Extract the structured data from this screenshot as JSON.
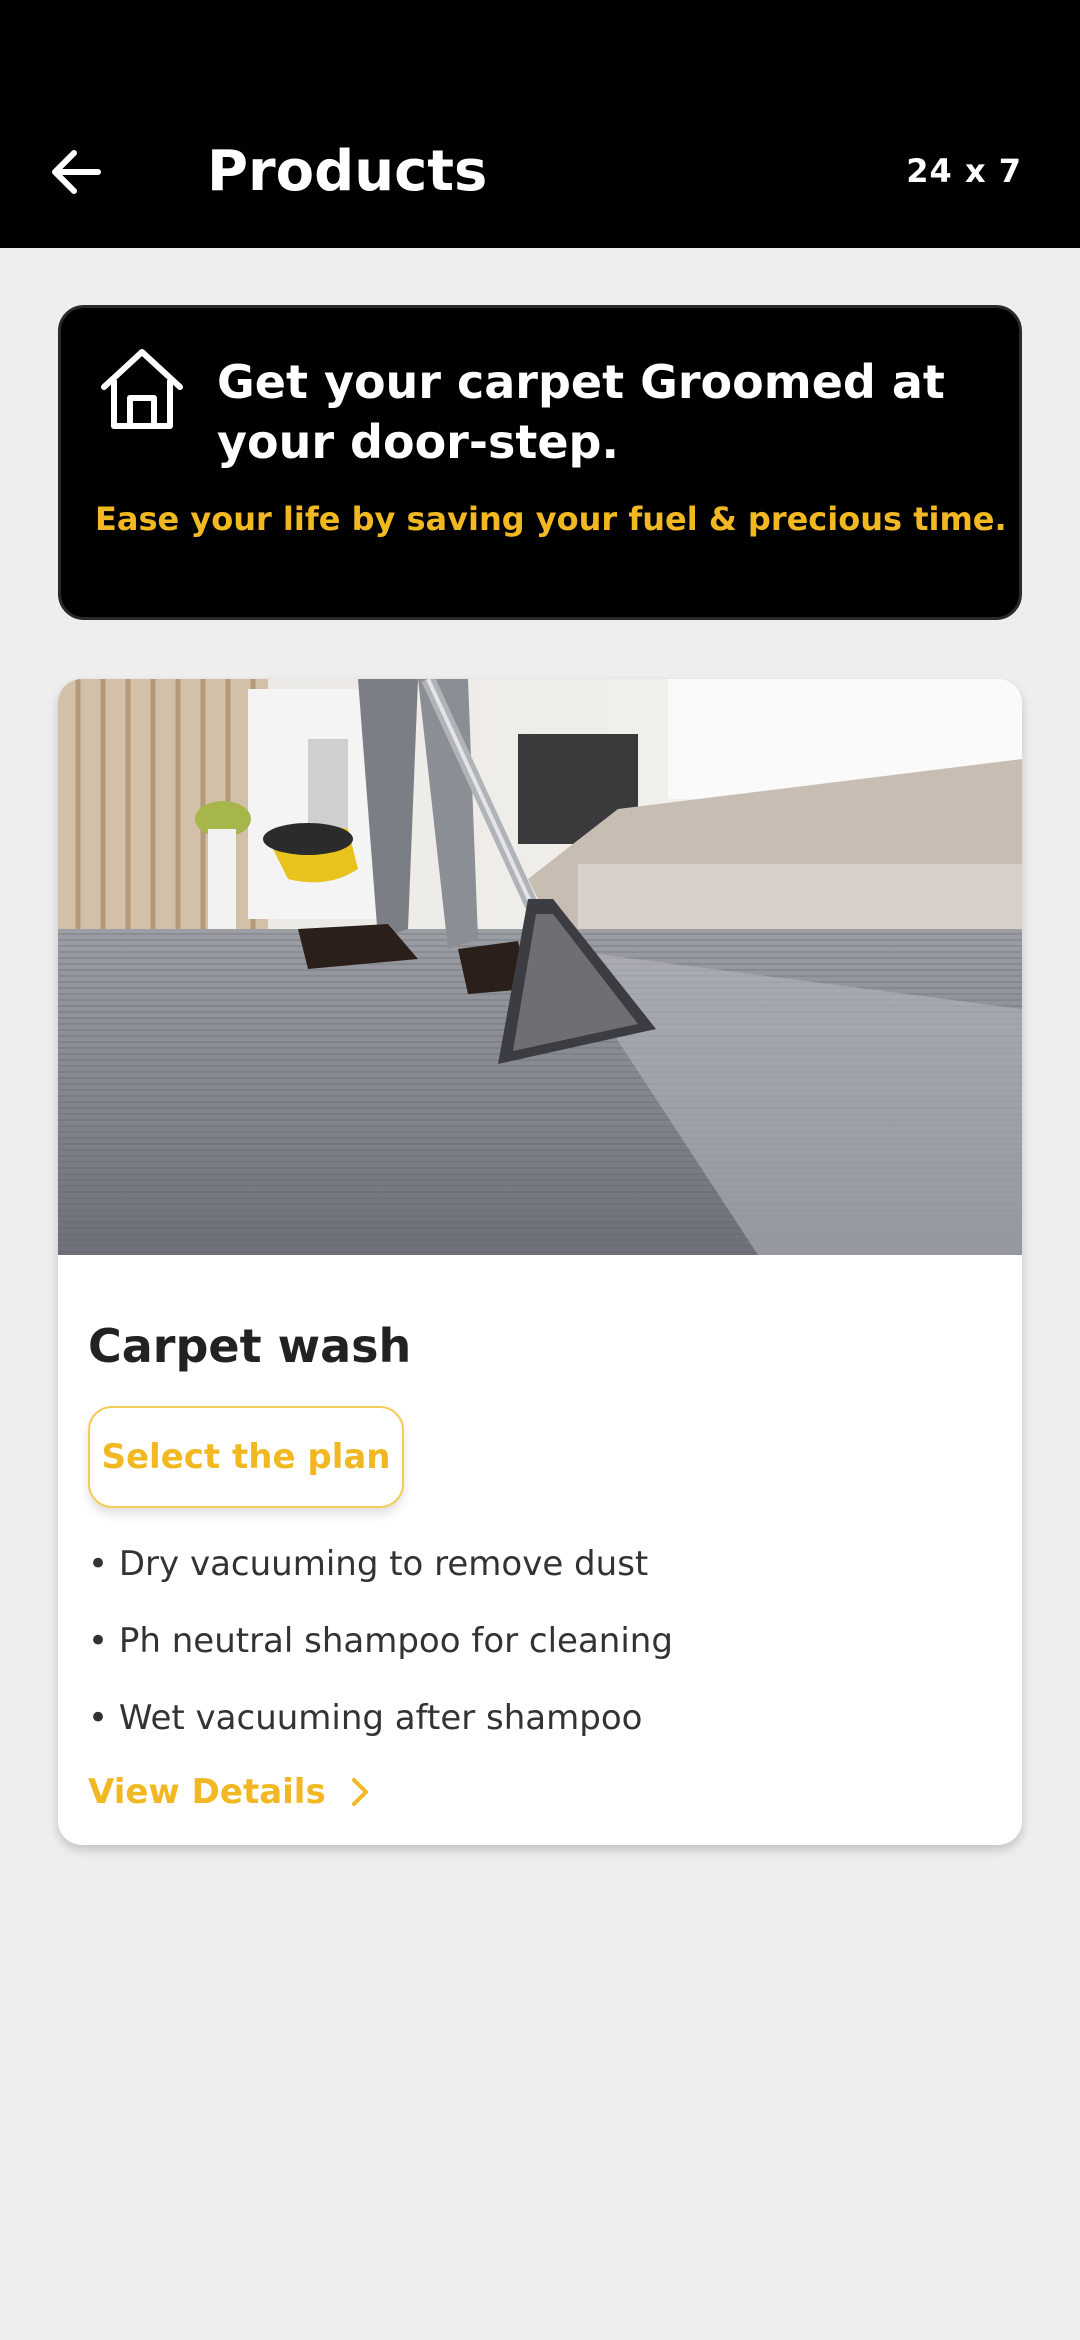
{
  "header": {
    "back_icon": "arrow-left-icon",
    "title": "Products",
    "availability": "24 x 7"
  },
  "banner": {
    "icon": "home-icon",
    "headline": "Get your carpet Groomed at your door-step.",
    "subtext": "Ease your life by saving your fuel & precious time."
  },
  "product": {
    "image_alt": "carpet-cleaning-photo",
    "title": "Carpet wash",
    "select_label": "Select the plan",
    "features": [
      "• Dry vacuuming to remove dust",
      "• Ph neutral shampoo for cleaning",
      "• Wet vacuuming after shampoo"
    ],
    "details_label": "View Details",
    "details_icon": "chevron-right-icon"
  },
  "colors": {
    "accent": "#f2b821",
    "header_bg": "#000000",
    "page_bg": "#eeeeee"
  }
}
